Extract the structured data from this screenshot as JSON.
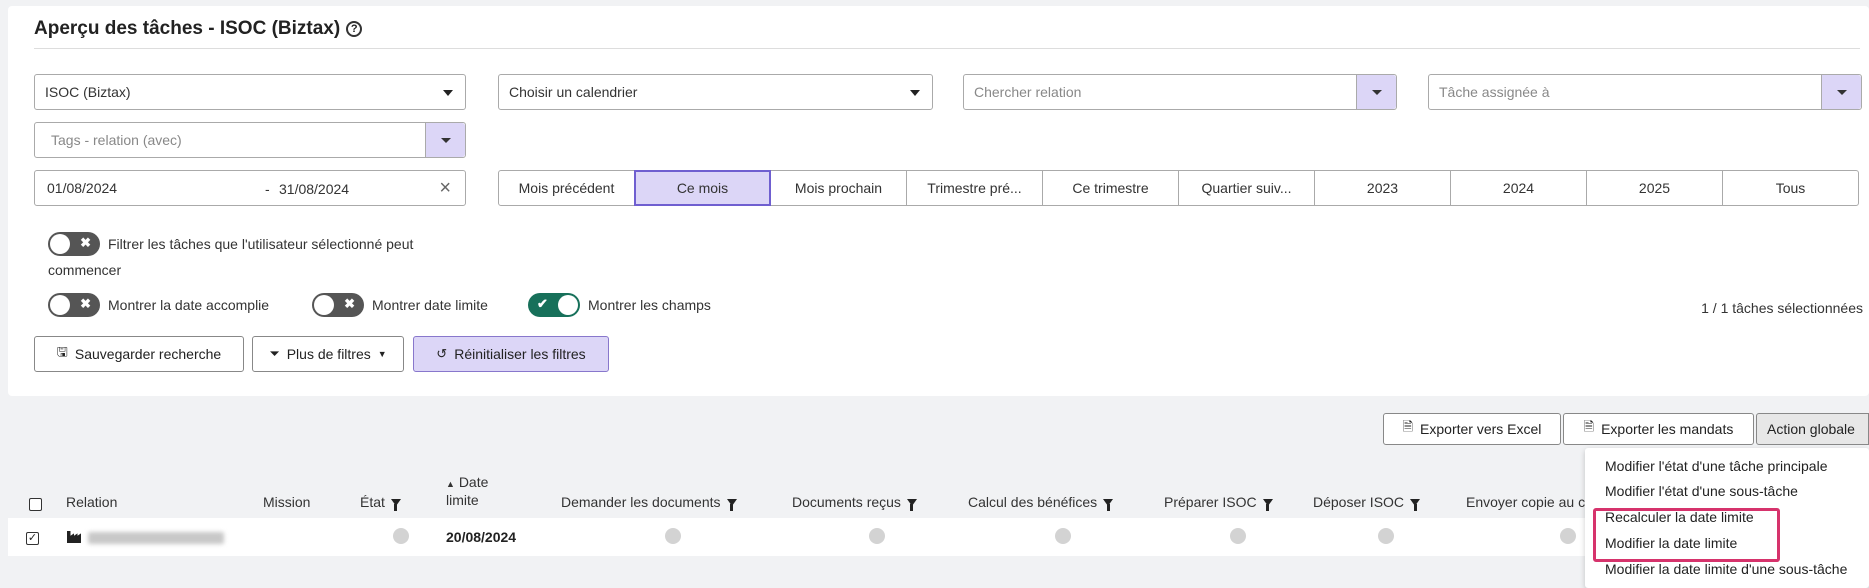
{
  "header": {
    "title": "Aperçu des tâches - ISOC (Biztax)",
    "help_icon": "question-circle-icon"
  },
  "filters": {
    "task_type": {
      "value": "ISOC (Biztax)"
    },
    "calendar": {
      "value": "Choisir un calendrier"
    },
    "relation": {
      "placeholder": "Chercher relation"
    },
    "assignee": {
      "placeholder": "Tâche assignée à"
    },
    "tags": {
      "placeholder": "Tags - relation (avec)"
    },
    "date_from": "01/08/2024",
    "date_sep": "-",
    "date_to": "31/08/2024",
    "periods": [
      {
        "label": "Mois précédent",
        "active": false
      },
      {
        "label": "Ce mois",
        "active": true
      },
      {
        "label": "Mois prochain",
        "active": false
      },
      {
        "label": "Trimestre pré...",
        "active": false
      },
      {
        "label": "Ce trimestre",
        "active": false
      },
      {
        "label": "Quartier suiv...",
        "active": false
      },
      {
        "label": "2023",
        "active": false
      },
      {
        "label": "2024",
        "active": false
      },
      {
        "label": "2025",
        "active": false
      },
      {
        "label": "Tous",
        "active": false
      }
    ]
  },
  "toggles": {
    "filter_startable": {
      "label_line1": "Filtrer les tâches que l'utilisateur sélectionné peut",
      "label_line2": "commencer",
      "on": false
    },
    "show_completed_date": {
      "label": "Montrer la date accomplie",
      "on": false
    },
    "show_deadline": {
      "label": "Montrer date limite",
      "on": false
    },
    "show_fields": {
      "label": "Montrer les champs",
      "on": true
    }
  },
  "selected_count": "1 / 1 tâches sélectionnées",
  "actions": {
    "save_search": "Sauvegarder recherche",
    "more_filters": "Plus de filtres",
    "reset_filters": "Réinitialiser les filtres",
    "export_excel": "Exporter vers Excel",
    "export_mandates": "Exporter les mandats",
    "global_action": "Action globale"
  },
  "table": {
    "headers": {
      "relation": "Relation",
      "mission": "Mission",
      "state": "État",
      "deadline_line1": "Date",
      "deadline_line2": "limite",
      "request_docs": "Demander les documents",
      "docs_received": "Documents reçus",
      "profit_calc": "Calcul des bénéfices",
      "prepare_isoc": "Préparer ISOC",
      "file_isoc": "Déposer ISOC",
      "send_copy": "Envoyer copie au c"
    },
    "rows": [
      {
        "deadline": "20/08/2024"
      }
    ]
  },
  "menu": {
    "items": [
      "Modifier l'état d'une tâche principale",
      "Modifier l'état d'une sous-tâche",
      "Recalculer la date limite",
      "Modifier la date limite",
      "Modifier la date limite d'une sous-tâche"
    ]
  },
  "colors": {
    "accent": "#dcd6f7",
    "accent_border": "#6f5fd0",
    "toggle_on": "#17705a",
    "highlight": "#d6336c"
  }
}
